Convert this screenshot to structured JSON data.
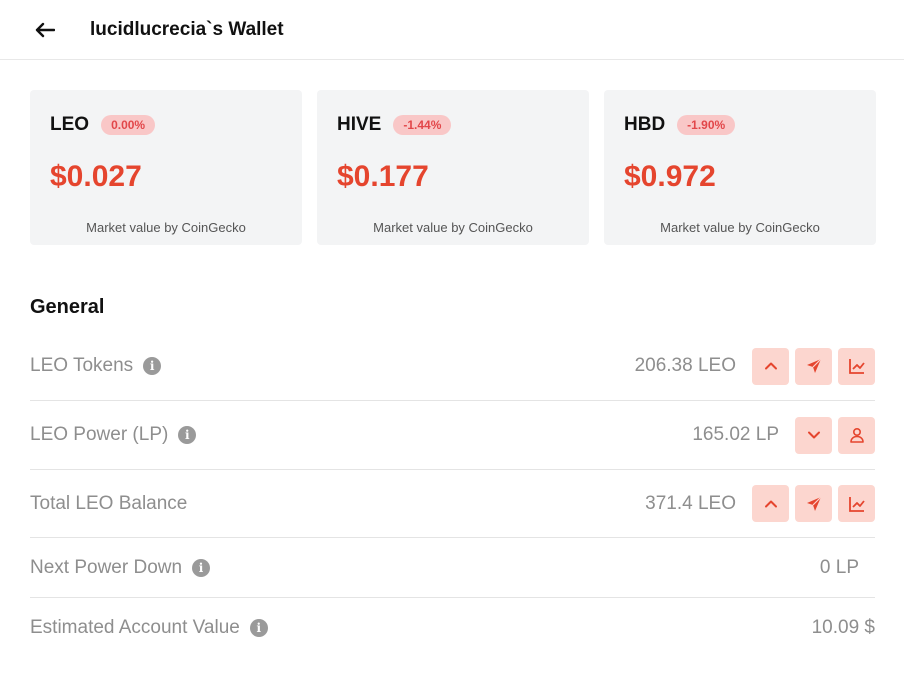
{
  "header": {
    "title": "lucidlucrecia`s Wallet"
  },
  "cards": [
    {
      "symbol": "LEO",
      "change": "0.00%",
      "price": "$0.027",
      "source": "Market value by CoinGecko"
    },
    {
      "symbol": "HIVE",
      "change": "-1.44%",
      "price": "$0.177",
      "source": "Market value by CoinGecko"
    },
    {
      "symbol": "HBD",
      "change": "-1.90%",
      "price": "$0.972",
      "source": "Market value by CoinGecko"
    }
  ],
  "general": {
    "title": "General",
    "rows": [
      {
        "label": "LEO Tokens",
        "value": "206.38 LEO"
      },
      {
        "label": "LEO Power (LP)",
        "value": "165.02 LP"
      },
      {
        "label": "Total LEO Balance",
        "value": "371.4 LEO"
      },
      {
        "label": "Next Power Down",
        "value": "0 LP"
      },
      {
        "label": "Estimated Account Value",
        "value": "10.09 $"
      }
    ]
  },
  "colors": {
    "accent": "#e5452e",
    "action_bg": "#fcd6cf",
    "badge_bg": "#f9c7c7",
    "card_bg": "#f3f4f5"
  },
  "icons": [
    "back-arrow-icon",
    "info-icon",
    "chevron-up-icon",
    "chevron-down-icon",
    "send-icon",
    "chart-icon",
    "user-icon"
  ]
}
